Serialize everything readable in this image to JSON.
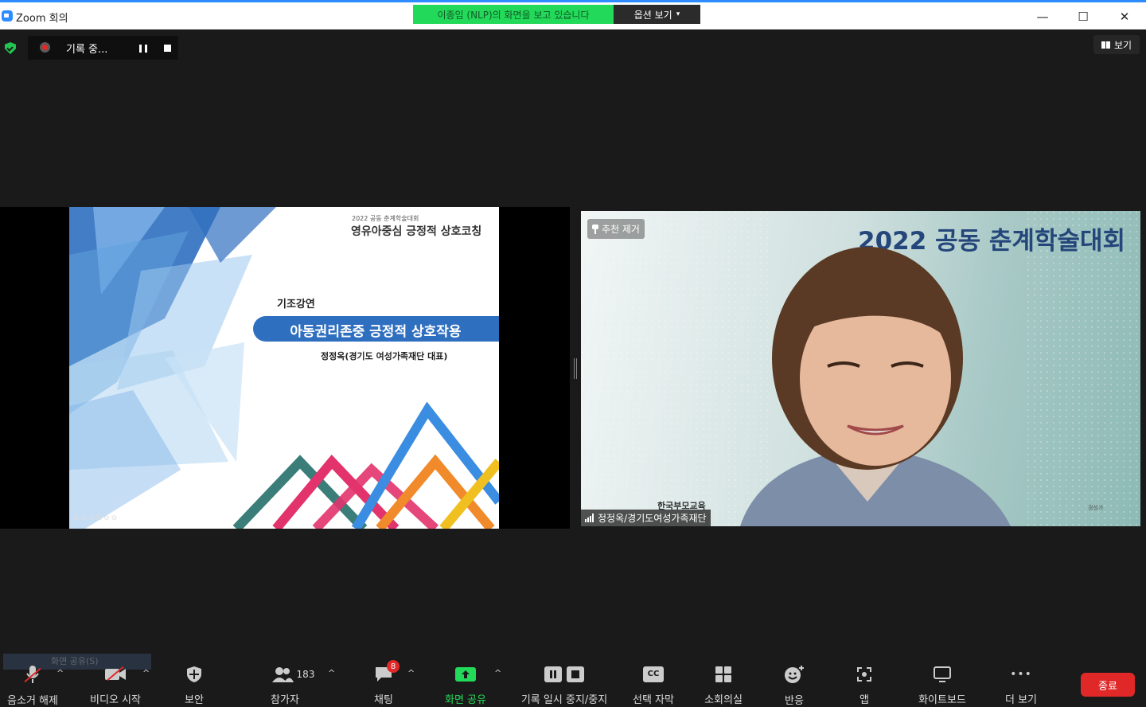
{
  "window": {
    "title": "Zoom 회의",
    "sharing_banner": "이종임 (NLP)의 화면을 보고 있습니다",
    "view_options_label": "옵션 보기",
    "controls": {
      "minimize": "—",
      "maximize": "☐",
      "close": "✕"
    }
  },
  "recording": {
    "label": "기록 중..."
  },
  "top_right": {
    "view_label": "보기"
  },
  "slide": {
    "subheading": "2022 공동 춘계학술대회",
    "top_title": "영유아중심 긍정적 상호코칭",
    "kicker": "기조강연",
    "title": "아동권리존중 긍정적 상호작용",
    "author": "정정옥(경기도 여성가족재단 대표)",
    "toolbar_glyphs": "⊖⊖⊘⊞⊖⊖"
  },
  "video": {
    "background_text": "2022 공동 춘계학술대회",
    "unpin_label": "추천 제거",
    "participant_name": "정정옥/경기도여성가족재단",
    "lower_logo": "한국부모교육",
    "corner_mark": "경성가"
  },
  "toolbar": {
    "ghost_note": "화면 공유(S)",
    "unmute_label": "음소거 해제",
    "video_label": "비디오 시작",
    "security_label": "보안",
    "participants_label": "참가자",
    "participants_count": "183",
    "chat_label": "채팅",
    "chat_badge": "8",
    "share_label": "화면 공유",
    "record_label": "기록 일시 중지/중지",
    "captions_label": "선택 자막",
    "captions_icon_text": "CC",
    "breakout_label": "소회의실",
    "reactions_label": "반응",
    "apps_label": "앱",
    "whiteboard_label": "화이트보드",
    "more_label": "더 보기",
    "more_icon_text": "•••",
    "end_label": "종료",
    "caret": "^"
  },
  "colors": {
    "zoom_blue": "#2d8cff",
    "share_green": "#23d959",
    "end_red": "#e02828",
    "slide_blue": "#2f6fbf"
  }
}
